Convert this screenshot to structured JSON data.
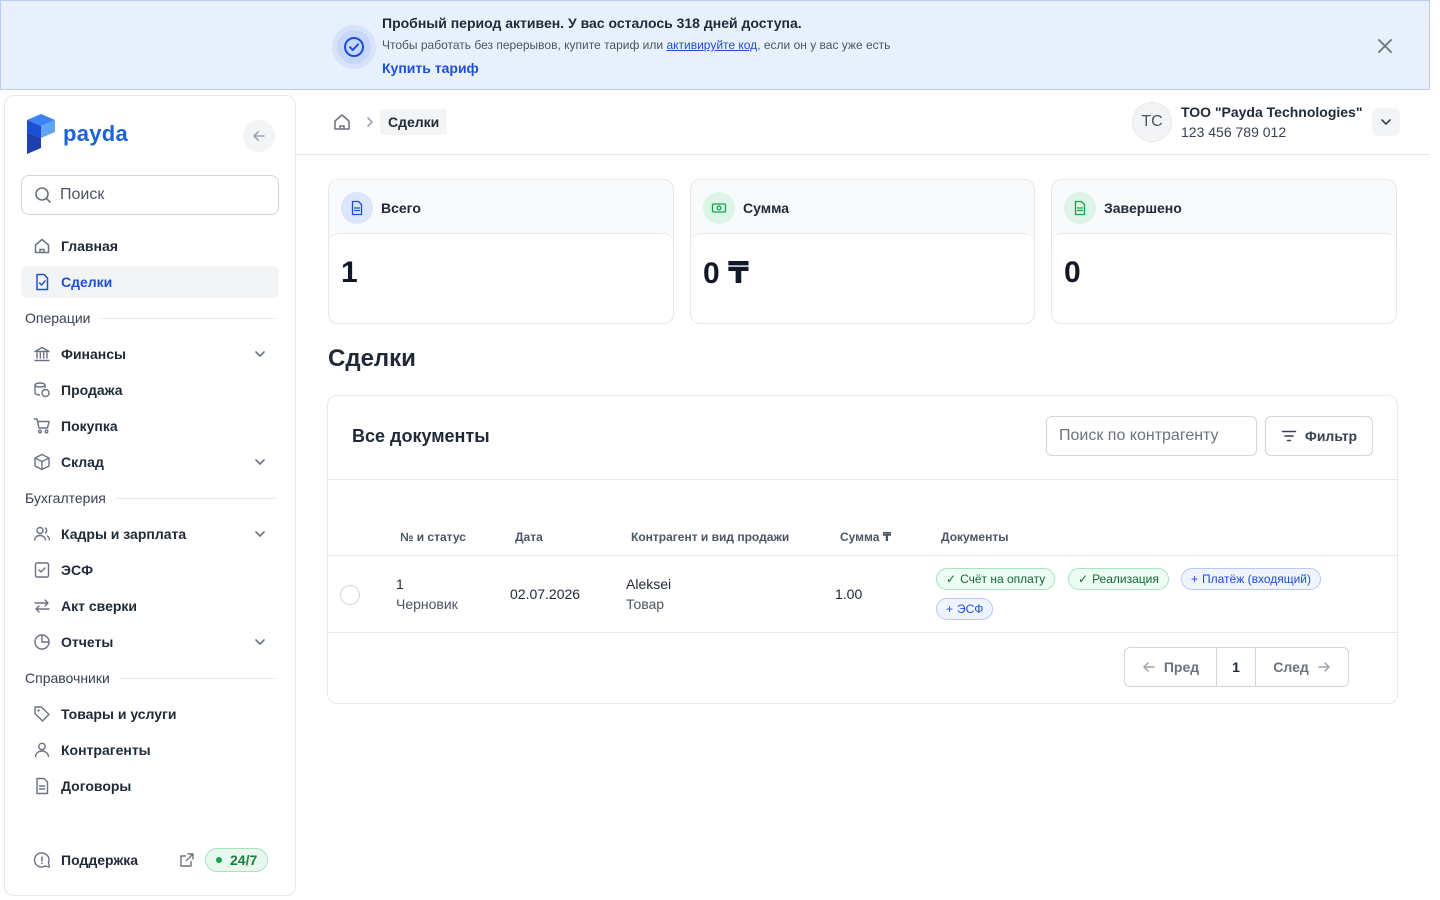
{
  "banner": {
    "title": "Пробный период активен. У вас осталось 318 дней доступа.",
    "text_before": "Чтобы работать без перерывов, купите тариф или ",
    "link": "активируйте код",
    "text_after": ", если он у вас уже есть",
    "buy": "Купить тариф"
  },
  "sidebar": {
    "logo": "payda",
    "search_placeholder": "Поиск",
    "items": {
      "home": "Главная",
      "deals": "Сделки",
      "section_operations": "Операции",
      "finance": "Финансы",
      "sales": "Продажа",
      "purchase": "Покупка",
      "warehouse": "Склад",
      "section_accounting": "Бухгалтерия",
      "hr": "Кадры и зарплата",
      "esf": "ЭСФ",
      "reconciliation": "Акт сверки",
      "reports": "Отчеты",
      "section_directories": "Справочники",
      "goods": "Товары и услуги",
      "counterparties": "Контрагенты",
      "contracts": "Договоры"
    },
    "support": "Поддержка",
    "support_badge": "24/7"
  },
  "topbar": {
    "breadcrumb_current": "Сделки",
    "avatar_initials": "TC",
    "company_name": "ТОО \"Payda Technologies\"",
    "company_bin": "123 456 789 012"
  },
  "stats": [
    {
      "label": "Всего",
      "value": "1"
    },
    {
      "label": "Сумма",
      "value": "0 ₸"
    },
    {
      "label": "Завершено",
      "value": "0"
    }
  ],
  "page_title": "Сделки",
  "docs": {
    "title": "Все документы",
    "search_placeholder": "Поиск по контрагенту",
    "filter": "Фильтр",
    "columns": [
      "№ и статус",
      "Дата",
      "Контрагент и вид продажи",
      "Сумма ₸",
      "Документы"
    ],
    "rows": [
      {
        "number": "1",
        "status": "Черновик",
        "date": "02.07.2026",
        "counterparty": "Aleksei",
        "kind": "Товар",
        "amount": "1.00",
        "documents": [
          {
            "label": "Счёт на оплату",
            "state": "done"
          },
          {
            "label": "Реализация",
            "state": "done"
          },
          {
            "label": "Платёж (входящий)",
            "state": "add"
          },
          {
            "label": "ЭСФ",
            "state": "add"
          }
        ]
      }
    ],
    "pager": {
      "prev": "Пред",
      "page": "1",
      "next": "След"
    }
  },
  "colors": {
    "brand": "#1d63d8",
    "banner_bg": "#e9f0fd",
    "success": "#16a34a"
  }
}
